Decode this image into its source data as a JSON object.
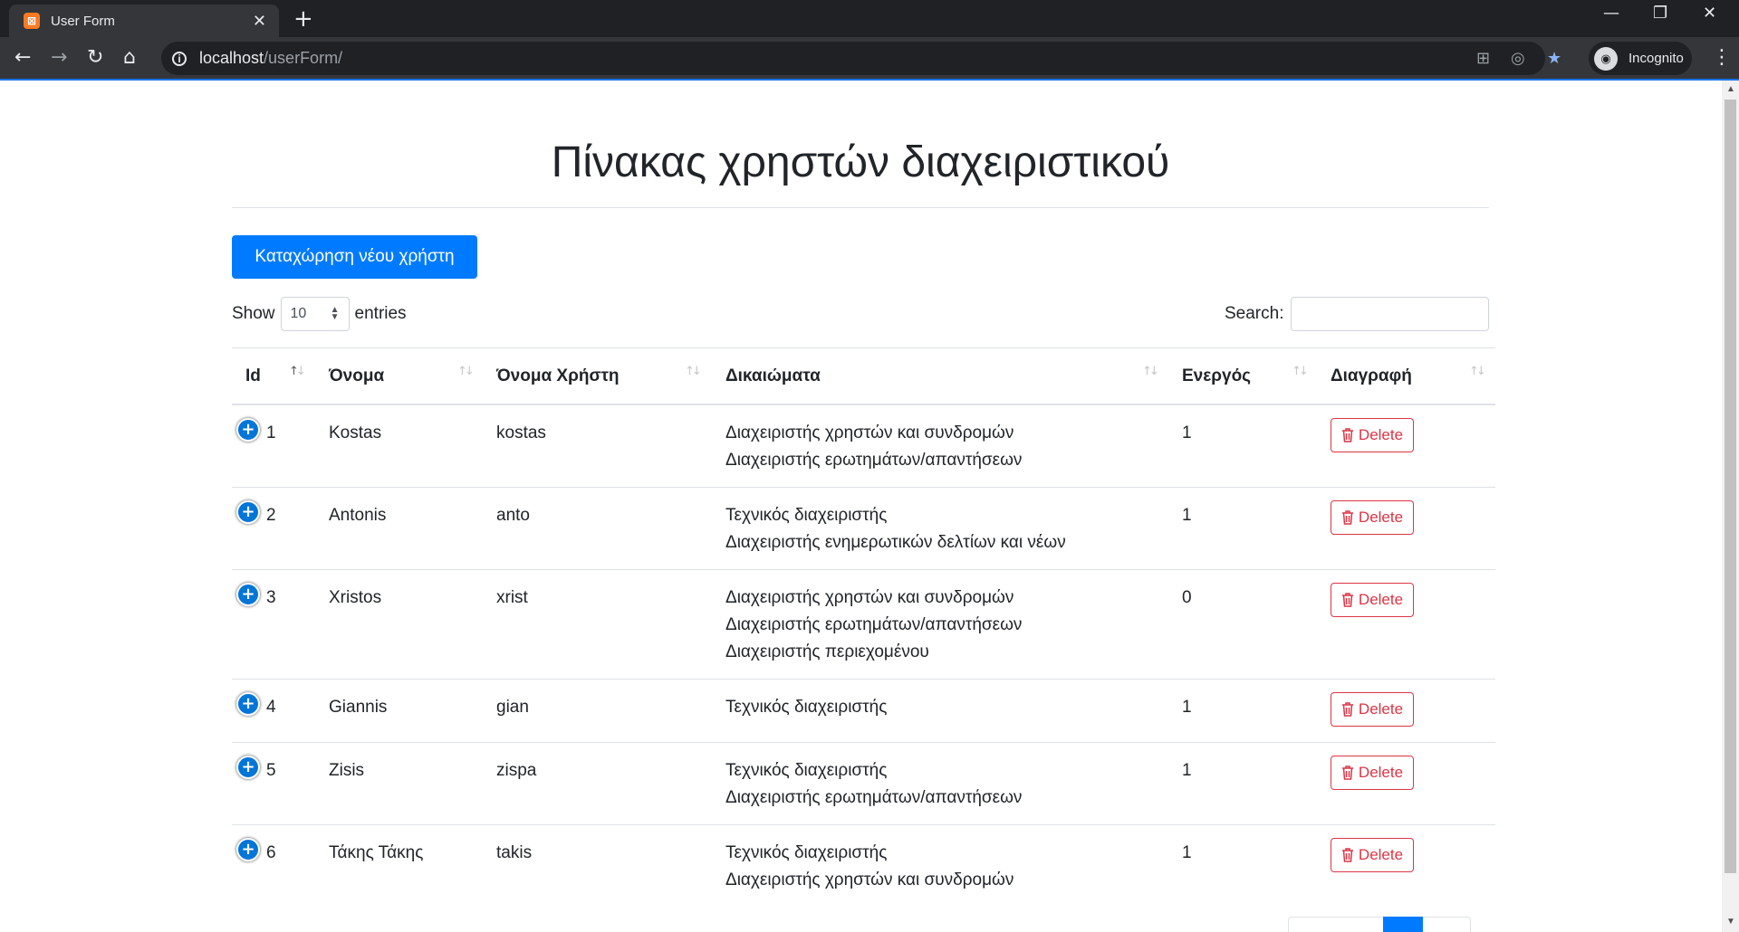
{
  "browser": {
    "tab_title": "User Form",
    "tab_favicon": "xampp-icon",
    "url_host": "localhost",
    "url_path": "/userForm/",
    "profile_label": "Incognito",
    "accent": "#1a73e8"
  },
  "page": {
    "title": "Πίνακας χρηστών διαχειριστικού",
    "add_button": "Καταχώρηση νέου χρήστη",
    "length_prefix": "Show",
    "length_value": "10",
    "length_suffix": "entries",
    "search_label": "Search:",
    "search_value": ""
  },
  "table": {
    "columns": [
      "Id",
      "Όνομα",
      "Όνομα Χρήστη",
      "Δικαιώματα",
      "Ενεργός",
      "Διαγραφή"
    ],
    "delete_label": "Delete",
    "rows": [
      {
        "id": "1",
        "name": "Kostas",
        "username": "kostas",
        "permissions": [
          "Διαχειριστής χρηστών και συνδρομών",
          "Διαχειριστής ερωτημάτων/απαντήσεων"
        ],
        "active": "1"
      },
      {
        "id": "2",
        "name": "Antonis",
        "username": "anto",
        "permissions": [
          "Τεχνικός διαχειριστής",
          "Διαχειριστής ενημερωτικών δελτίων και νέων"
        ],
        "active": "1"
      },
      {
        "id": "3",
        "name": "Xristos",
        "username": "xrist",
        "permissions": [
          "Διαχειριστής χρηστών και συνδρομών",
          "Διαχειριστής ερωτημάτων/απαντήσεων",
          "Διαχειριστής περιεχομένου"
        ],
        "active": "0"
      },
      {
        "id": "4",
        "name": "Giannis",
        "username": "gian",
        "permissions": [
          "Τεχνικός διαχειριστής"
        ],
        "active": "1"
      },
      {
        "id": "5",
        "name": "Zisis",
        "username": "zispa",
        "permissions": [
          "Τεχνικός διαχειριστής",
          "Διαχειριστής ερωτημάτων/απαντήσεων"
        ],
        "active": "1"
      },
      {
        "id": "6",
        "name": "Τάκης Τάκης",
        "username": "takis",
        "permissions": [
          "Τεχνικός διαχειριστής",
          "Διαχειριστής χρηστών και συνδρομών"
        ],
        "active": "1"
      }
    ]
  },
  "colors": {
    "primary": "#007bff",
    "danger": "#dc3545",
    "expand": "#0275d8"
  }
}
